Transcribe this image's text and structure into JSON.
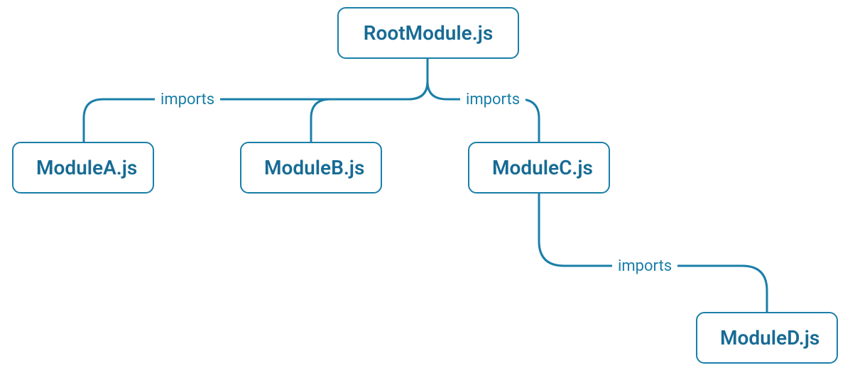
{
  "nodes": {
    "root": {
      "label": "RootModule.js"
    },
    "a": {
      "label": "ModuleA.js"
    },
    "b": {
      "label": "ModuleB.js"
    },
    "c": {
      "label": "ModuleC.js"
    },
    "d": {
      "label": "ModuleD.js"
    }
  },
  "edges": {
    "root_to_children_left": {
      "label": "imports"
    },
    "root_to_children_right": {
      "label": "imports"
    },
    "c_to_d": {
      "label": "imports"
    }
  }
}
